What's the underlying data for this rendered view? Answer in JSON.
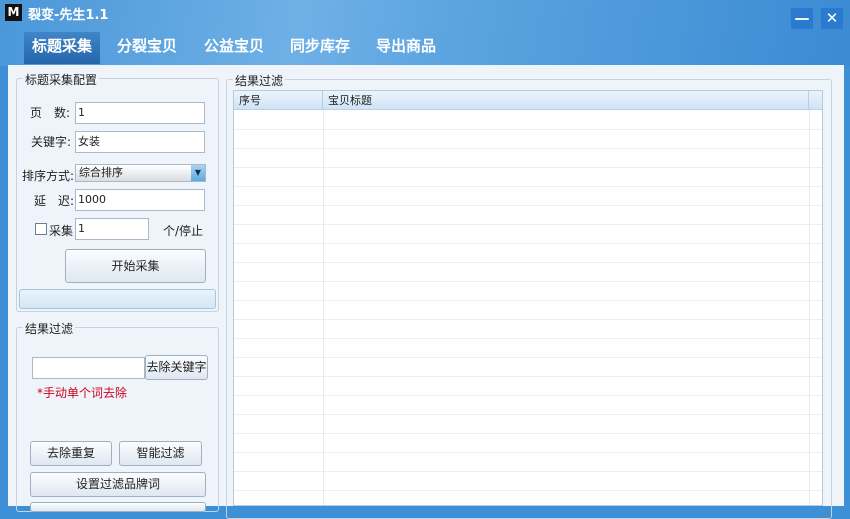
{
  "window": {
    "logo": "M",
    "title": "裂变-先生1.1",
    "minimize": "—",
    "close": "✕"
  },
  "tabs": [
    {
      "label": "标题采集"
    },
    {
      "label": "分裂宝贝"
    },
    {
      "label": "公益宝贝"
    },
    {
      "label": "同步库存"
    },
    {
      "label": "导出商品"
    }
  ],
  "config": {
    "group_label": "标题采集配置",
    "pages_label": "页　数:",
    "pages_value": "1",
    "keyword_label": "关键字:",
    "keyword_value": "女装",
    "sort_label": "排序方式:",
    "sort_value": "综合排序",
    "delay_label": "延　迟:",
    "delay_value": "1000",
    "collect_label": "采集",
    "collect_value": "1",
    "collect_suffix": "个/停止",
    "start_button": "开始采集"
  },
  "filter": {
    "group_label": "结果过滤",
    "keyword_input": "",
    "remove_keyword_button": "去除关键字",
    "hint": "*手动单个词去除",
    "dedupe_button": "去除重复",
    "smart_button": "智能过滤",
    "brand_button": "设置过滤品牌词"
  },
  "results": {
    "group_label": "结果过滤",
    "columns": [
      "序号",
      "宝贝标题"
    ]
  },
  "colors": {
    "accent": "#3d8fd6",
    "hint": "#d0021b"
  }
}
